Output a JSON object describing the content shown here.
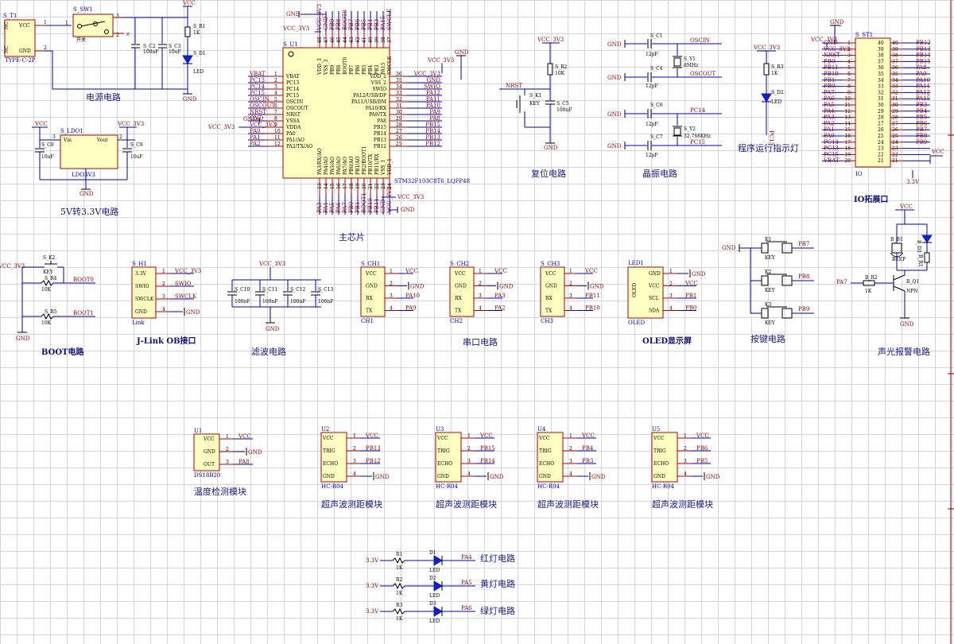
{
  "section_titles": {
    "power": "电源电路",
    "ldo": "5V转3.3V电路",
    "mcu": "主芯片",
    "reset": "复位电路",
    "crystal": "晶振电路",
    "run_led": "程序运行指示灯",
    "io": "IO拓展口",
    "boot": "BOOT电路",
    "jlink": "J-Link OB接口",
    "filter": "滤波电路",
    "uart": "串口电路",
    "oled": "OLED显示屏",
    "keys": "按键电路",
    "alarm": "声光报警电路",
    "temp": "温度检测模块",
    "us1": "超声波测距模块",
    "us2": "超声波测距模块",
    "us3": "超声波测距模块",
    "us4": "超声波测距模块",
    "red": "红灯电路",
    "yellow": "黄灯电路",
    "green": "绿灯电路"
  },
  "nets": {
    "vcc": "VCC",
    "vcc3v3": "VCC_3V3",
    "gnd": "GND",
    "v33": "3.3V",
    "nrst": "NRST",
    "boot0": "BOOT0",
    "boot1": "BOOT1",
    "swio": "SWIO",
    "swclk": "SWCLK",
    "oscin": "OSCIN",
    "oscout": "OSCOUT",
    "pc14": "PC14",
    "pc15": "PC15"
  },
  "power": {
    "ti_ref": "S_T1",
    "ti_type": "TYPE-C-2P",
    "ti_pins": [
      "NC",
      "VCC",
      "NC",
      "GND"
    ],
    "sw_ref": "S_SW1",
    "sw_label": "开关",
    "c2_ref": "S_C2",
    "c2_val": "100nF",
    "c3_ref": "S_C3",
    "c3_val": "10uF",
    "r1_ref": "S_R1",
    "r1_val": "1K",
    "d1_ref": "S_D1",
    "d1_val": "LED"
  },
  "ldo": {
    "ref": "S_LDO1",
    "part": "LDO3V3",
    "pin_vin": "Vin",
    "pin_vout": "Vout",
    "c8_ref": "S_C8",
    "c8_val": "10uF",
    "c9_ref": "S_C9",
    "c9_val": "10uF"
  },
  "mcu": {
    "ref": "S_U1",
    "part": "STM32F103C8T6_LQFP48",
    "left_pins": [
      {
        "num": "1",
        "name": "VBAT",
        "net": "VBAT"
      },
      {
        "num": "2",
        "name": "PC13",
        "net": "PC13"
      },
      {
        "num": "3",
        "name": "PC14",
        "net": "PC14"
      },
      {
        "num": "4",
        "name": "PC15",
        "net": "PC15"
      },
      {
        "num": "5",
        "name": "OSCIN",
        "net": "OSCIN"
      },
      {
        "num": "6",
        "name": "OSCOUT",
        "net": "OSCOUT"
      },
      {
        "num": "7",
        "name": "NRST",
        "net": "NRST"
      },
      {
        "num": "8",
        "name": "VSSA",
        "net": "GND"
      },
      {
        "num": "9",
        "name": "VDDA",
        "net": "VCC_3V3"
      },
      {
        "num": "10",
        "name": "PA0",
        "net": "PA0"
      },
      {
        "num": "11",
        "name": "PA1/AO",
        "net": "PA1"
      },
      {
        "num": "12",
        "name": "PA2/TX/AO",
        "net": "PA2"
      }
    ],
    "right_pins": [
      {
        "num": "36",
        "name": "VDD_2",
        "net": "VCC_3V3"
      },
      {
        "num": "35",
        "name": "VSS_2",
        "net": "GND"
      },
      {
        "num": "34",
        "name": "SWIO",
        "net": "SWIO"
      },
      {
        "num": "33",
        "name": "PA12/USB/DP",
        "net": "PA12"
      },
      {
        "num": "32",
        "name": "PA11/USB/DM",
        "net": "PA11"
      },
      {
        "num": "31",
        "name": "PA10/RX",
        "net": "PA10"
      },
      {
        "num": "30",
        "name": "PA9/TX",
        "net": "PA9"
      },
      {
        "num": "29",
        "name": "PA8",
        "net": "PA8"
      },
      {
        "num": "28",
        "name": "PB15",
        "net": "PB15"
      },
      {
        "num": "27",
        "name": "PB14",
        "net": "PB14"
      },
      {
        "num": "26",
        "name": "PB13",
        "net": "PB13"
      },
      {
        "num": "25",
        "name": "PB12",
        "net": "PB12"
      }
    ],
    "top_pins": [
      {
        "num": "48",
        "name": "VDD_3",
        "net": "VCC_3V3"
      },
      {
        "num": "47",
        "name": "VSS_3",
        "net": "GND"
      },
      {
        "num": "46",
        "name": "PB9",
        "net": "PB9"
      },
      {
        "num": "45",
        "name": "PB8",
        "net": "PB8"
      },
      {
        "num": "44",
        "name": "BOOT0",
        "net": "BOOT0"
      },
      {
        "num": "43",
        "name": "PB7",
        "net": "PB7"
      },
      {
        "num": "42",
        "name": "PB6",
        "net": "PB6"
      },
      {
        "num": "41",
        "name": "PB5",
        "net": "PB5"
      },
      {
        "num": "40",
        "name": "PB4",
        "net": "PB4"
      },
      {
        "num": "39",
        "name": "PB3",
        "net": "PB3"
      },
      {
        "num": "38",
        "name": "PA15",
        "net": "PA15"
      },
      {
        "num": "37",
        "name": "SWCLK",
        "net": "SWCLK"
      }
    ],
    "bottom_pins": [
      {
        "num": "13",
        "name": "PA3/RX/AO",
        "net": "PA3"
      },
      {
        "num": "14",
        "name": "PA4/AO",
        "net": "PA4"
      },
      {
        "num": "15",
        "name": "PA5/AO",
        "net": "PA5"
      },
      {
        "num": "16",
        "name": "PA6/AO",
        "net": "PA6"
      },
      {
        "num": "17",
        "name": "PA7/AO",
        "net": "PA7"
      },
      {
        "num": "18",
        "name": "PB0/AO",
        "net": "PB0"
      },
      {
        "num": "19",
        "name": "PB1/AO",
        "net": "PB1"
      },
      {
        "num": "20",
        "name": "PB2/BOOT1",
        "net": "BOOT1"
      },
      {
        "num": "21",
        "name": "PB10/TX",
        "net": "PB10"
      },
      {
        "num": "22",
        "name": "PB11/RX",
        "net": "PB11"
      },
      {
        "num": "23",
        "name": "VSS_1",
        "net": "GND"
      },
      {
        "num": "24",
        "name": "VDD_1",
        "net": "VCC_3V3"
      }
    ]
  },
  "reset": {
    "r_ref": "S_R2",
    "r_val": "10K",
    "k_ref": "S_K1",
    "k_val": "KEY",
    "c_ref": "S_C5",
    "c_val": "100nF"
  },
  "crystal": {
    "c1_ref": "S_C1",
    "c4_ref": "S_C4",
    "c6_ref": "S_C6",
    "c7_ref": "S_C7",
    "cap_val": "12pF",
    "y1_ref": "S_Y1",
    "y1_val": "8MHz",
    "y2_ref": "S_Y2",
    "y2_val": "32.768KHz"
  },
  "run_led": {
    "r_ref": "S_R3",
    "r_val": "1K",
    "d_ref": "S_D2",
    "d_val": "LED",
    "net": "PC13"
  },
  "io": {
    "ref": "S_ST1",
    "name": "IO",
    "left": [
      {
        "num": "1",
        "net": "GND"
      },
      {
        "num": "2",
        "net": "VCC_3V3"
      },
      {
        "num": "3",
        "net": "NRST"
      },
      {
        "num": "4",
        "net": "PB0"
      },
      {
        "num": "5",
        "net": "PB11"
      },
      {
        "num": "6",
        "net": "PB10"
      },
      {
        "num": "7",
        "net": "PB1"
      },
      {
        "num": "8",
        "net": "PB0"
      },
      {
        "num": "9",
        "net": "PA7"
      },
      {
        "num": "10",
        "net": "PA6"
      },
      {
        "num": "11",
        "net": "PA5"
      },
      {
        "num": "12",
        "net": "PA4"
      },
      {
        "num": "13",
        "net": "PA3"
      },
      {
        "num": "14",
        "net": "PA2"
      },
      {
        "num": "15",
        "net": "PA1"
      },
      {
        "num": "16",
        "net": "PA0"
      },
      {
        "num": "17",
        "net": "PC14"
      },
      {
        "num": "18",
        "net": "PC13"
      },
      {
        "num": "19",
        "net": "PC15"
      },
      {
        "num": "20",
        "net": "VBAT"
      }
    ],
    "right": [
      {
        "num": "40",
        "net": "PB12"
      },
      {
        "num": "39",
        "net": "PB13"
      },
      {
        "num": "38",
        "net": "PB14"
      },
      {
        "num": "37",
        "net": "PB15"
      },
      {
        "num": "36",
        "net": "PA8"
      },
      {
        "num": "35",
        "net": "PA9"
      },
      {
        "num": "34",
        "net": "PA10"
      },
      {
        "num": "33",
        "net": "PA11"
      },
      {
        "num": "32",
        "net": "PA12"
      },
      {
        "num": "31",
        "net": "PA15"
      },
      {
        "num": "30",
        "net": "PB3"
      },
      {
        "num": "29",
        "net": "PB4"
      },
      {
        "num": "28",
        "net": "PB5"
      },
      {
        "num": "27",
        "net": "PB6"
      },
      {
        "num": "26",
        "net": "PB7"
      },
      {
        "num": "25",
        "net": "PB8"
      },
      {
        "num": "24",
        "net": "PB9"
      },
      {
        "num": "23",
        "net": ""
      },
      {
        "num": "22",
        "net": ""
      },
      {
        "num": "21",
        "net": ""
      }
    ],
    "bottom_net": "3.3V"
  },
  "boot": {
    "k_ref": "S_K2",
    "k_val": "KEY",
    "r4_ref": "S_R4",
    "r4_val": "10K",
    "r5_ref": "S_R5",
    "r5_val": "10K"
  },
  "jlink": {
    "ref": "S_H1",
    "footer": "Link",
    "pins": [
      {
        "num": "1",
        "name": "3.3V",
        "net": "VCC_3V3"
      },
      {
        "num": "2",
        "name": "SWIO",
        "net": "SWIO"
      },
      {
        "num": "3",
        "name": "SWCLK",
        "net": "SWCLK"
      },
      {
        "num": "4",
        "name": "GND",
        "net": "GND"
      }
    ]
  },
  "filter": {
    "caps": [
      {
        "ref": "S_C10",
        "val": "100nF"
      },
      {
        "ref": "S_C11",
        "val": "100nF"
      },
      {
        "ref": "S_C12",
        "val": "100nF"
      },
      {
        "ref": "S_C13",
        "val": "100nF"
      }
    ]
  },
  "uart": [
    {
      "ref": "S_CH1",
      "footer": "CH1",
      "rx": "PA10",
      "tx": "PA9"
    },
    {
      "ref": "S_CH2",
      "footer": "CH2",
      "rx": "PA3",
      "tx": "PA2"
    },
    {
      "ref": "S_CH3",
      "footer": "CH3",
      "rx": "PB11",
      "tx": "PB10"
    }
  ],
  "uart_pin_names": [
    "VCC",
    "GND",
    "RX",
    "TX"
  ],
  "oled": {
    "ref": "LED1",
    "footer": "OLED",
    "body": "OLED",
    "pins": [
      "GND",
      "VCC",
      "SCL",
      "SDA"
    ],
    "nets": [
      "GND",
      "VCC",
      "PB1",
      "PB0"
    ]
  },
  "keys": [
    {
      "ref": "K1",
      "val": "KEY",
      "net": "PB7"
    },
    {
      "ref": "K2",
      "val": "KEY",
      "net": "PB8"
    },
    {
      "ref": "K3",
      "val": "KEY",
      "net": "PB9"
    }
  ],
  "alarm": {
    "beep_ref": "B_B1",
    "beep_val": "BEEP",
    "d_ref": "B_D1",
    "r1_ref": "B_R1",
    "r2_ref": "B_R2",
    "r2_val": "1K",
    "q_ref": "B_Q1",
    "q_val": "NPN",
    "in_net": "PA7"
  },
  "temp": {
    "ref": "U1",
    "footer": "DS18B20",
    "pins": [
      "VCC",
      "GND",
      "OUT"
    ],
    "out_net": "PA8"
  },
  "ultrasonic": [
    {
      "ref": "U2",
      "footer": "HC-R04",
      "trig": "PB13",
      "echo": "PB12"
    },
    {
      "ref": "U3",
      "footer": "HC-R04",
      "trig": "PB15",
      "echo": "PB14"
    },
    {
      "ref": "U4",
      "footer": "HC-R04",
      "trig": "PB4",
      "echo": "PB3"
    },
    {
      "ref": "U5",
      "footer": "HC-R04",
      "trig": "PB6",
      "echo": "PB5"
    }
  ],
  "us_pin_names": [
    "VCC",
    "TRIG",
    "ECHO",
    "GND"
  ],
  "lights": [
    {
      "r_ref": "R1",
      "r_val": "1K",
      "d_ref": "D1",
      "d_val": "LED",
      "net": "PA4"
    },
    {
      "r_ref": "R2",
      "r_val": "1K",
      "d_ref": "D2",
      "d_val": "LED",
      "net": "PA5"
    },
    {
      "r_ref": "R3",
      "r_val": "1K",
      "d_ref": "D3",
      "d_val": "LED",
      "net": "PA6"
    }
  ]
}
